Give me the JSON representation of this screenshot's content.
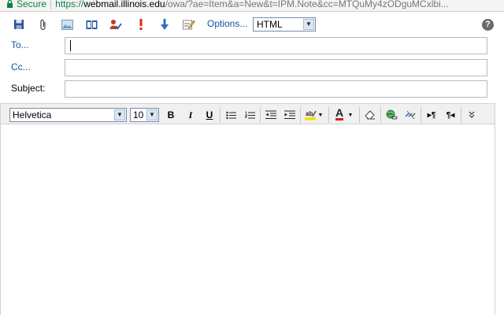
{
  "address_bar": {
    "secure_label": "Secure",
    "separator": "|",
    "scheme": "https://",
    "host": "webmail.illinois.edu",
    "path": "/owa/?ae=Item&a=New&t=IPM.Note&cc=MTQuMy4zODguMCxlbi..."
  },
  "toolbar": {
    "icons": [
      "save-icon",
      "attach-icon",
      "insert-image-icon",
      "address-book-icon",
      "check-names-icon",
      "importance-high-icon",
      "importance-low-icon",
      "signature-icon"
    ],
    "options_label": "Options...",
    "format_value": "HTML",
    "help_glyph": "?"
  },
  "fields": {
    "to_label": "To...",
    "cc_label": "Cc...",
    "subject_label": "Subject:"
  },
  "format_bar": {
    "font_value": "Helvetica",
    "size_value": "10",
    "bold": "B",
    "italic": "I",
    "underline": "U",
    "font_color_glyph": "A"
  },
  "colors": {
    "link": "#1a4fa3",
    "secure_green": "#0b8043",
    "font_color_red": "#d21f1f",
    "highlight_yellow": "#f2e200"
  }
}
